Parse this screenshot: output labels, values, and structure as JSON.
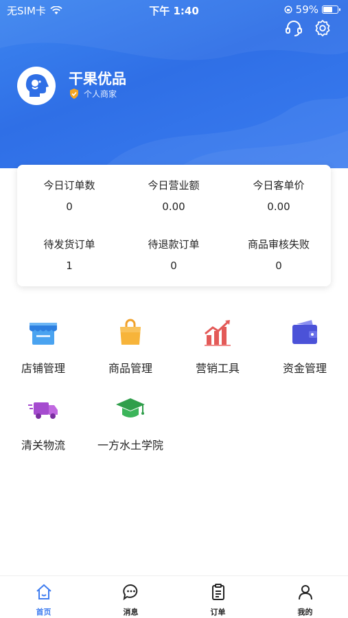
{
  "status_bar": {
    "carrier": "无SIM卡",
    "time": "下午 1:40",
    "battery": "59%",
    "battery_level": 0.59
  },
  "header": {
    "shop_name": "干果优品",
    "merchant_type": "个人商家"
  },
  "stats": [
    {
      "label": "今日订单数",
      "value": "0"
    },
    {
      "label": "今日营业额",
      "value": "0.00"
    },
    {
      "label": "今日客单价",
      "value": "0.00"
    },
    {
      "label": "待发货订单",
      "value": "1"
    },
    {
      "label": "待退款订单",
      "value": "0"
    },
    {
      "label": "商品审核失败",
      "value": "0"
    }
  ],
  "menu": [
    {
      "label": "店铺管理",
      "icon": "store-icon"
    },
    {
      "label": "商品管理",
      "icon": "shopping-bag-icon"
    },
    {
      "label": "营销工具",
      "icon": "chart-growth-icon"
    },
    {
      "label": "资金管理",
      "icon": "wallet-icon"
    },
    {
      "label": "清关物流",
      "icon": "truck-icon"
    },
    {
      "label": "一方水土学院",
      "icon": "graduation-cap-icon"
    }
  ],
  "tabbar": [
    {
      "label": "首页",
      "icon": "home-icon",
      "active": true
    },
    {
      "label": "消息",
      "icon": "message-icon",
      "active": false
    },
    {
      "label": "订单",
      "icon": "order-icon",
      "active": false
    },
    {
      "label": "我的",
      "icon": "user-icon",
      "active": false
    }
  ],
  "colors": {
    "primary": "#3478f0",
    "active_tab": "#3f7df0"
  }
}
